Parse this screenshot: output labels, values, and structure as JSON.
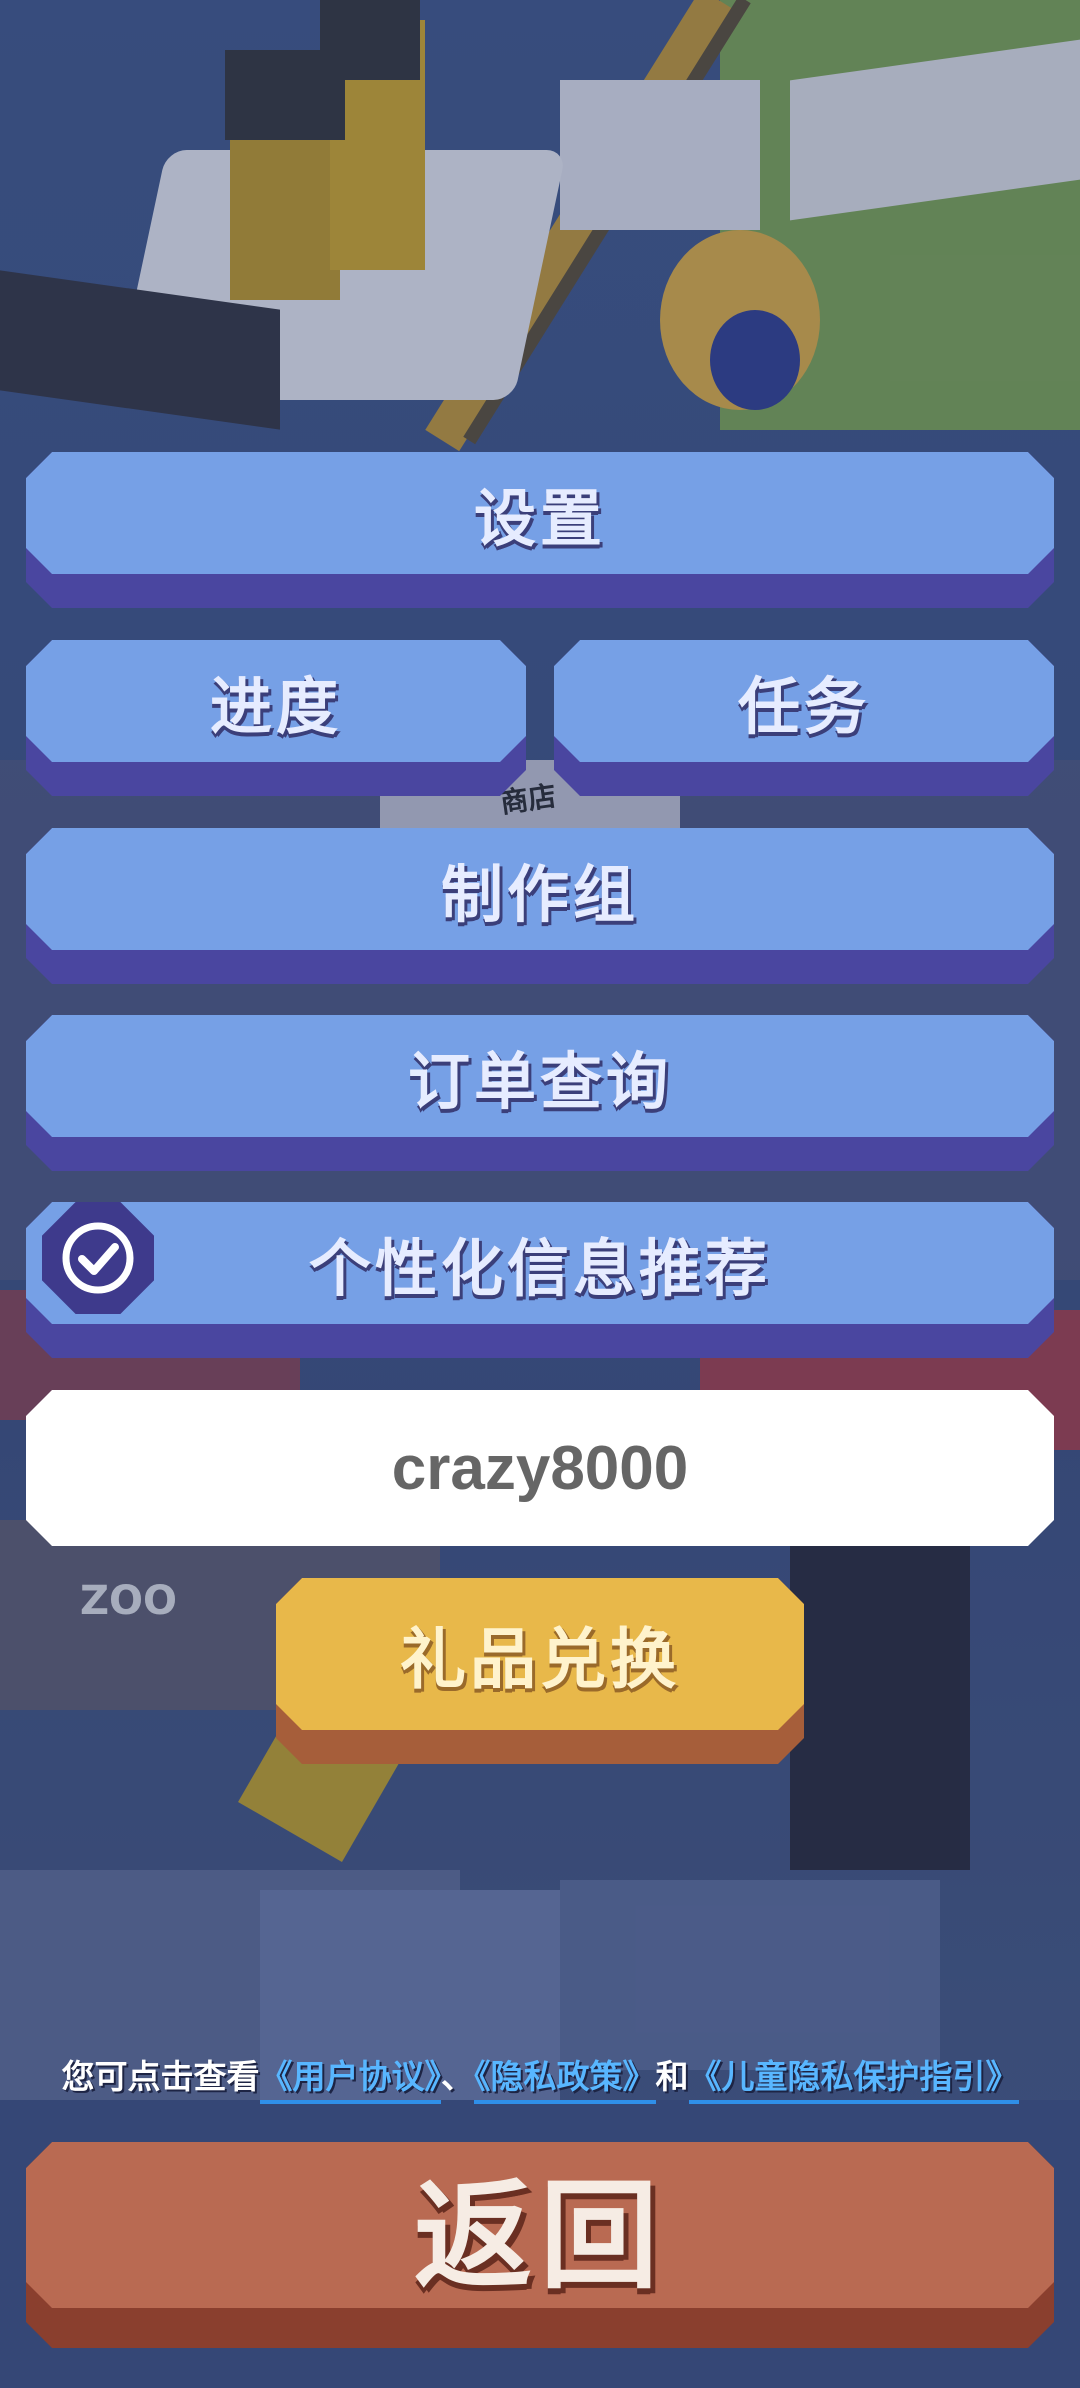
{
  "menu": {
    "settings": "设置",
    "progress": "进度",
    "tasks": "任务",
    "credits": "制作组",
    "orders": "订单查询",
    "personalized": "个性化信息推荐",
    "personalized_checked": true
  },
  "code_field": {
    "value": "crazy8000"
  },
  "redeem_button": "礼品兑换",
  "agreement": {
    "prefix": "您可点击查看",
    "user_agreement": "《用户协议》",
    "sep": "、",
    "privacy_policy": "《隐私政策》",
    "and": "和",
    "child_privacy": "《儿童隐私保护指引》"
  },
  "back_button": "返回",
  "scene_labels": {
    "shop": "商店",
    "zoo": "ZOO"
  },
  "colors": {
    "menu_blue": "#76a0e6",
    "menu_shadow": "#4a46a0",
    "gold": "#e8b84a",
    "back_red": "#b96a52",
    "link_blue": "#58b6ff"
  }
}
